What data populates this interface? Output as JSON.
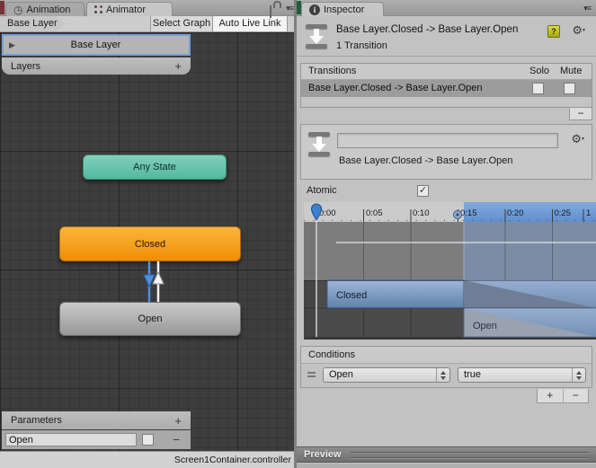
{
  "colors": {
    "selection_blue": "#6B9BD8",
    "playhead_blue": "#3F7FD0",
    "any_state_teal": "#5FBFA5",
    "closed_node_orange": "#F49C1D",
    "open_node_gray": "#ABABAB",
    "graph_background": "#3D3D3D"
  },
  "animator": {
    "tabs": {
      "animation": "Animation",
      "animator": "Animator"
    },
    "toolbar": {
      "breadcrumb": "Base Layer",
      "select_graph": "Select Graph",
      "auto_live_link": "Auto Live Link"
    },
    "layer_widget": {
      "name": "Base Layer"
    },
    "layers_bar": {
      "title": "Layers",
      "add": "+"
    },
    "nodes": {
      "any_state": "Any State",
      "closed": "Closed",
      "open": "Open"
    },
    "parameters": {
      "title": "Parameters",
      "add": "+",
      "row": {
        "name": "Open",
        "remove": "−"
      }
    },
    "status_bar": {
      "controller": "Screen1Container.controller"
    }
  },
  "inspector": {
    "tab": "Inspector",
    "header": {
      "title": "Base Layer.Closed -> Base Layer.Open",
      "subtitle": "1 Transition"
    },
    "transitions": {
      "title": "Transitions",
      "solo": "Solo",
      "mute": "Mute",
      "row": "Base Layer.Closed -> Base Layer.Open",
      "remove": "−"
    },
    "name_block": {
      "value": "",
      "label": "Base Layer.Closed -> Base Layer.Open"
    },
    "atomic": {
      "label": "Atomic",
      "check": "✓"
    },
    "timeline": {
      "ticks": [
        "0:00",
        "0:05",
        "0:10",
        "0:15",
        "0:20",
        "0:25",
        "1"
      ],
      "closed_bar": "Closed",
      "open_bar": "Open"
    },
    "conditions": {
      "title": "Conditions",
      "row": {
        "parameter": "Open",
        "value": "true"
      },
      "add": "+",
      "remove": "−"
    },
    "preview": {
      "title": "Preview"
    }
  }
}
